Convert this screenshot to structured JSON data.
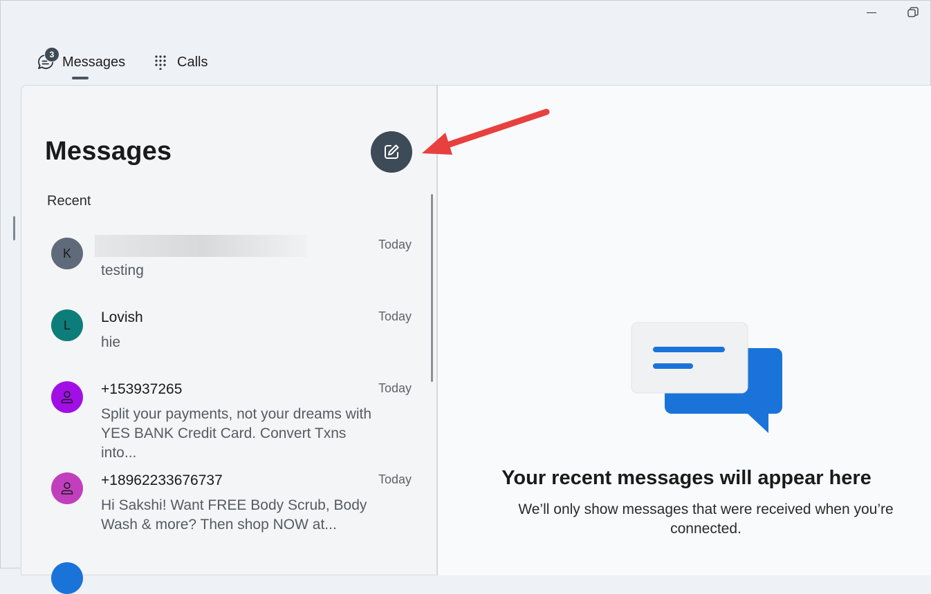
{
  "tabs": {
    "messages_label": "Messages",
    "messages_badge": "3",
    "calls_label": "Calls"
  },
  "panel": {
    "title": "Messages",
    "section_label": "Recent"
  },
  "conversations": [
    {
      "avatar_letter": "K",
      "avatar_color": "#5f6b7a",
      "name": "",
      "snippet": "testing",
      "time": "Today",
      "avatar_icon": "letter"
    },
    {
      "avatar_letter": "L",
      "avatar_color": "#0d7d7a",
      "name": "Lovish",
      "snippet": "hie",
      "time": "Today",
      "avatar_icon": "letter"
    },
    {
      "avatar_letter": "",
      "avatar_color": "#a10fe6",
      "name": "+153937265",
      "snippet": "Split your payments, not your dreams with YES BANK Credit Card. Convert Txns into...",
      "time": "Today",
      "avatar_icon": "person-icon"
    },
    {
      "avatar_letter": "",
      "avatar_color": "#c13fbd",
      "name": "+18962233676737",
      "snippet": "Hi Sakshi! Want FREE Body Scrub, Body Wash & more? Then shop NOW at...",
      "time": "Today",
      "avatar_icon": "person-icon"
    }
  ],
  "empty_state": {
    "title": "Your recent messages will appear here",
    "subtitle": "We’ll only show messages that were received when you’re connected."
  },
  "colors": {
    "compose_button": "#3d4a57",
    "annotation_arrow": "#e8403f",
    "bubble_blue": "#1a73d9"
  }
}
